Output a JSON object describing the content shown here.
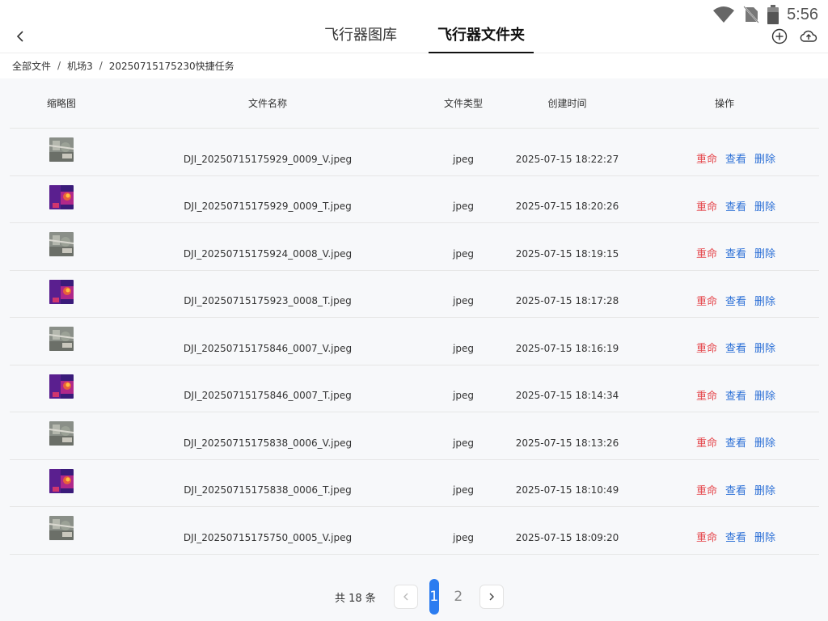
{
  "status": {
    "time": "5:56"
  },
  "header": {
    "tabs": [
      {
        "label": "飞行器图库",
        "active": false
      },
      {
        "label": "飞行器文件夹",
        "active": true
      }
    ]
  },
  "breadcrumb": {
    "items": [
      "全部文件",
      "机场3",
      "20250715175230快捷任务"
    ],
    "separator": "/"
  },
  "table": {
    "columns": {
      "thumb": "缩略图",
      "name": "文件名称",
      "type": "文件类型",
      "time": "创建时间",
      "ops": "操作"
    },
    "actions": {
      "rename": "重命",
      "view": "查看",
      "delete": "删除"
    },
    "rows": [
      {
        "name": "DJI_20250715175929_0009_V.jpeg",
        "type": "jpeg",
        "time": "2025-07-15 18:22:27",
        "thumb_kind": "visual"
      },
      {
        "name": "DJI_20250715175929_0009_T.jpeg",
        "type": "jpeg",
        "time": "2025-07-15 18:20:26",
        "thumb_kind": "thermal"
      },
      {
        "name": "DJI_20250715175924_0008_V.jpeg",
        "type": "jpeg",
        "time": "2025-07-15 18:19:15",
        "thumb_kind": "visual"
      },
      {
        "name": "DJI_20250715175923_0008_T.jpeg",
        "type": "jpeg",
        "time": "2025-07-15 18:17:28",
        "thumb_kind": "thermal"
      },
      {
        "name": "DJI_20250715175846_0007_V.jpeg",
        "type": "jpeg",
        "time": "2025-07-15 18:16:19",
        "thumb_kind": "visual"
      },
      {
        "name": "DJI_20250715175846_0007_T.jpeg",
        "type": "jpeg",
        "time": "2025-07-15 18:14:34",
        "thumb_kind": "thermal"
      },
      {
        "name": "DJI_20250715175838_0006_V.jpeg",
        "type": "jpeg",
        "time": "2025-07-15 18:13:26",
        "thumb_kind": "visual"
      },
      {
        "name": "DJI_20250715175838_0006_T.jpeg",
        "type": "jpeg",
        "time": "2025-07-15 18:10:49",
        "thumb_kind": "thermal"
      },
      {
        "name": "DJI_20250715175750_0005_V.jpeg",
        "type": "jpeg",
        "time": "2025-07-15 18:09:20",
        "thumb_kind": "visual"
      }
    ]
  },
  "pagination": {
    "total_text": "共 18 条",
    "pages": [
      "1",
      "2"
    ],
    "current": "1"
  },
  "colors": {
    "rename": "#e5484d",
    "link": "#2b6fd6",
    "active_page": "#2b7cf0"
  }
}
